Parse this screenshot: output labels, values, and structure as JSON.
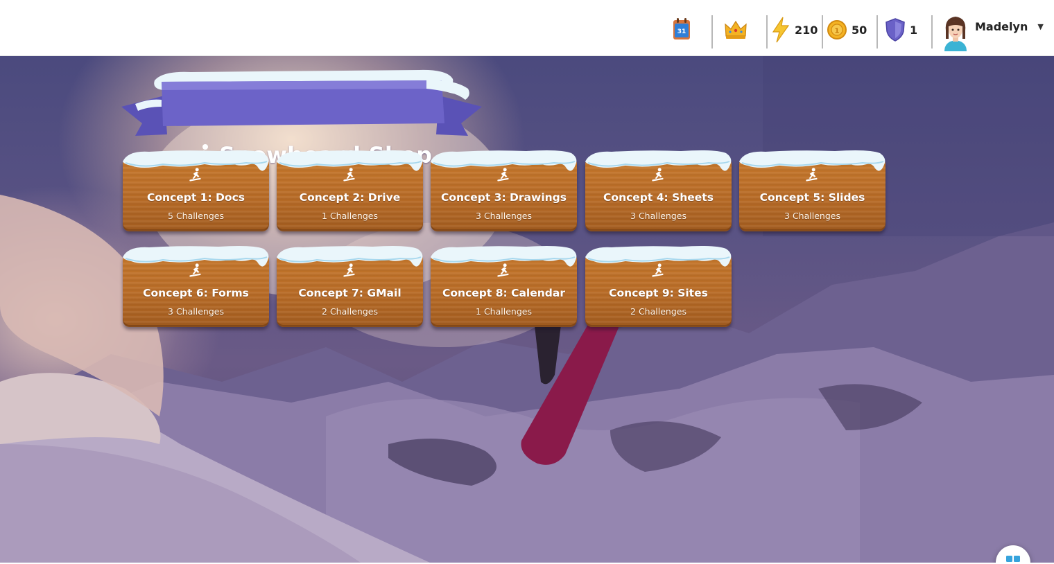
{
  "header": {
    "stats": {
      "energy": "210",
      "coins": "50",
      "shields": "1"
    },
    "user": {
      "name": "Madelyn"
    },
    "calendar_icon_text": "31"
  },
  "shop": {
    "title": "Snowboard Shop",
    "concepts": [
      {
        "title": "Concept 1: Docs",
        "challenges": "5 Challenges"
      },
      {
        "title": "Concept 2: Drive",
        "challenges": "1 Challenges"
      },
      {
        "title": "Concept 3: Drawings",
        "challenges": "3 Challenges"
      },
      {
        "title": "Concept 4: Sheets",
        "challenges": "3 Challenges"
      },
      {
        "title": "Concept 5: Slides",
        "challenges": "3 Challenges"
      },
      {
        "title": "Concept 6: Forms",
        "challenges": "3 Challenges"
      },
      {
        "title": "Concept 7: GMail",
        "challenges": "2 Challenges"
      },
      {
        "title": "Concept 8: Calendar",
        "challenges": "1 Challenges"
      },
      {
        "title": "Concept 9: Sites",
        "challenges": "2 Challenges"
      }
    ]
  },
  "icons": {
    "calendar": "calendar-icon",
    "leaderboard": "crown-icon",
    "energy": "lightning-icon",
    "coins": "coin-icon",
    "shields": "shield-icon",
    "avatar": "avatar",
    "concept": "snowboarder-icon",
    "fab": "grid-icon"
  },
  "colors": {
    "banner": "#6c63c8",
    "wood": "#b86b26",
    "snow": "#eaf6fb",
    "board": "#8a1a4a"
  }
}
